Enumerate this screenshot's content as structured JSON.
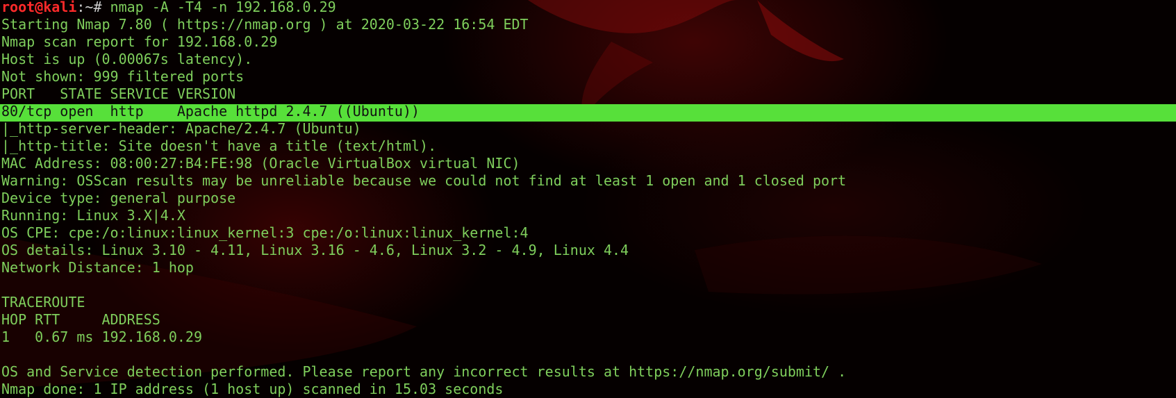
{
  "prompt": {
    "user_host": "root@kali",
    "path_symbol": ":~# ",
    "command": "nmap -A -T4 -n 192.168.0.29"
  },
  "output": {
    "l1": "Starting Nmap 7.80 ( https://nmap.org ) at 2020-03-22 16:54 EDT",
    "l2": "Nmap scan report for 192.168.0.29",
    "l3": "Host is up (0.00067s latency).",
    "l4": "Not shown: 999 filtered ports",
    "l5": "PORT   STATE SERVICE VERSION",
    "l6": "80/tcp open  http    Apache httpd 2.4.7 ((Ubuntu))",
    "l7": "|_http-server-header: Apache/2.4.7 (Ubuntu)",
    "l8": "|_http-title: Site doesn't have a title (text/html).",
    "l9": "MAC Address: 08:00:27:B4:FE:98 (Oracle VirtualBox virtual NIC)",
    "l10": "Warning: OSScan results may be unreliable because we could not find at least 1 open and 1 closed port",
    "l11": "Device type: general purpose",
    "l12": "Running: Linux 3.X|4.X",
    "l13": "OS CPE: cpe:/o:linux:linux_kernel:3 cpe:/o:linux:linux_kernel:4",
    "l14": "OS details: Linux 3.10 - 4.11, Linux 3.16 - 4.6, Linux 3.2 - 4.9, Linux 4.4",
    "l15": "Network Distance: 1 hop",
    "l16": "",
    "l17": "TRACEROUTE",
    "l18": "HOP RTT     ADDRESS",
    "l19": "1   0.67 ms 192.168.0.29",
    "l20": "",
    "l21": "OS and Service detection performed. Please report any incorrect results at https://nmap.org/submit/ .",
    "l22": "Nmap done: 1 IP address (1 host up) scanned in 15.03 seconds"
  },
  "colors": {
    "text_green": "#7fcf5c",
    "highlight_bg": "#57e03a",
    "prompt_red": "#ff2a2a",
    "background": "#050000"
  }
}
